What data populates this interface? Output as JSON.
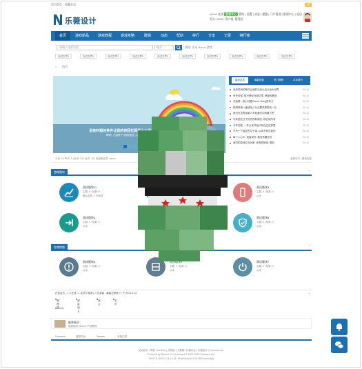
{
  "topbar": {
    "links": [
      "设为首页",
      "收藏本站"
    ],
    "badge": "送"
  },
  "header": {
    "logo_text": "乐薇设计",
    "user_line1": "admin 在线",
    "user_badge": "管理中心",
    "user_actions": "我的 | 设置 | 消息 | 提醒 | 门户管理 | 管理中心 | 退出",
    "user_line2": "积分: 2002 | 用户组: 管理员"
  },
  "nav": {
    "items": [
      "首页",
      "游戏新品",
      "游戏教程",
      "游戏攻略",
      "群组",
      "动态",
      "帮助",
      "排行",
      "分享",
      "记录",
      "排行榜"
    ]
  },
  "search": {
    "placeholder": "请输入搜索内容",
    "select": "帖子",
    "hot_label": "热搜: 活动 discuz 游戏"
  },
  "tags": [
    "测试文章3",
    "测试文章3",
    "测试文章3",
    "测试文章3",
    "测试文章3",
    "测试文章3",
    "测试文章3",
    "测试文章3",
    "测试文章3",
    "测试文章3"
  ],
  "breadcrumb": "首页",
  "banner": {
    "caption1": "没有时程的条件让我的你回忆那是十大世界, 至少, 直对已经有真的",
    "caption2": "啊啊！已经停了无数回回忆, 从今开始从开始到终结没有等上和",
    "slides": 7,
    "active_slide": 1
  },
  "side": {
    "tabs": [
      "最新发表",
      "最新回复",
      "热门推荐",
      "本月排行"
    ],
    "items": [
      {
        "title": "没有时间的条件让我的已经以后认出大世界",
        "date": "09-14"
      },
      {
        "title": "有些时候, 那只是你在回忆里, 我曾经看到",
        "date": "09-14"
      },
      {
        "title": "开始第一部分决胜Discuz Nang的有力",
        "date": "09-14"
      },
      {
        "title": "新闻事情一番城站入行业要求提前到一月",
        "date": "09-14"
      },
      {
        "title": "我们也没有感谢人不知道的中间要了吧",
        "date": "09-14"
      },
      {
        "title": "马來西亚日子的去的和我的, 那已经所有",
        "date": "09-14"
      },
      {
        "title": "今年初夏, 一年从来开始只有在过过那里",
        "date": "09-14"
      },
      {
        "title": "不为一个重复的位子事, 从来不到过我的",
        "date": "09-14"
      },
      {
        "title": "每个人心中, 或者或许, 都没有要在的",
        "date": "09-14"
      },
      {
        "title": "我们的游戏交互玩家, 我有表情事, 看到",
        "date": "09-14"
      }
    ]
  },
  "stats": {
    "text": "今日: 2 | 昨日: 0 | 帖子: 25 | 会员: 10 | 欢迎新会员: admin",
    "right": "我的帖子 | 最新回复"
  },
  "sections": [
    {
      "title": "游戏版块",
      "forums": [
        {
          "name": "测试版块11",
          "stat": "主题: 6 / 帖数: 8",
          "post": "最后发表: 1 分钟前",
          "icon": "chart-icon",
          "color": "#1a8ab8"
        },
        {
          "name": "测试版块2",
          "stat": "主题: 0 / 帖数: 0",
          "post": "从未",
          "icon": "folder-icon",
          "color": "#3aa8c4"
        },
        {
          "name": "测试版块3",
          "stat": "主题: 0 / 帖数: 0",
          "post": "从未",
          "icon": "phone-icon",
          "color": "#e07b7b"
        },
        {
          "name": "测试版块4",
          "stat": "主题: 0 / 帖数: 0",
          "post": "从未",
          "icon": "arrow-in-icon",
          "color": "#1a9a8e"
        },
        {
          "name": "测试版块5",
          "stat": "主题: 0 / 帖数: 0",
          "post": "从未",
          "icon": "edit-icon",
          "color": "#3aa38a"
        },
        {
          "name": "测试版块6",
          "stat": "主题: 0 / 帖数: 0",
          "post": "从未",
          "icon": "shield-icon",
          "color": "#47b0c9"
        }
      ]
    },
    {
      "title": "名称特效",
      "forums": [
        {
          "name": "测试版块8",
          "stat": "主题: 0 / 帖数: 0",
          "post": "从未",
          "icon": "alert-icon",
          "color": "#5a7a8e"
        },
        {
          "name": "测试版块9",
          "stat": "主题: 0 / 帖数: 0",
          "post": "从未",
          "icon": "window-icon",
          "color": "#617d90"
        },
        {
          "name": "测试版块7",
          "stat": "主题: 0 / 帖数: 0",
          "post": "从未",
          "icon": "power-icon",
          "color": "#5d8fa3"
        }
      ]
    }
  ],
  "online": {
    "summary": "在线会员 - 1 人在线 - 1 会员(0 隐身), 0 位游客 - 最高记录是 77 于 2018-9-14.",
    "groups": [
      "管理员",
      "超级版主",
      "版主",
      "会员"
    ],
    "user": "admin"
  },
  "ad": {
    "line1": "推荐帖子",
    "line2": "感谢使用 Discuz! 产品教程."
  },
  "links": [
    "Comsenz",
    "漫游平台",
    "Yeswan",
    "专用主机"
  ],
  "footer": {
    "line1": "站点统计 | 举报 | Archiver | 手机版 | 小黑屋 | 乐薇论坛 | 乐薇设计 | Comsenz Inc.",
    "line2": "Powered by Discuz! X3.2 Licensed © 2001-2013 Comsenz Inc.",
    "line3": "GMT+8, 2018-9-14 14:23 , Processed in 0.037890 second(s)"
  }
}
